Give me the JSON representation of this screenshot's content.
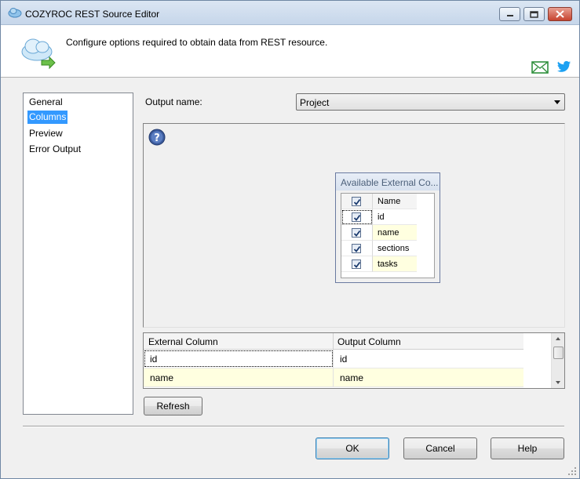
{
  "window": {
    "title": "COZYROC REST Source Editor"
  },
  "header": {
    "description": "Configure options required to obtain data from REST resource.",
    "icons": [
      "cloud-arrow-icon",
      "mail-icon",
      "twitter-icon"
    ]
  },
  "nav": {
    "items": [
      {
        "label": "General",
        "selected": false
      },
      {
        "label": "Columns",
        "selected": true
      },
      {
        "label": "Preview",
        "selected": false
      },
      {
        "label": "Error Output",
        "selected": false
      }
    ]
  },
  "output": {
    "label": "Output name:",
    "value": "Project"
  },
  "external_columns_box": {
    "title": "Available External Co...",
    "header": "Name",
    "header_checked": true,
    "columns": [
      {
        "name": "id",
        "checked": true
      },
      {
        "name": "name",
        "checked": true
      },
      {
        "name": "sections",
        "checked": true
      },
      {
        "name": "tasks",
        "checked": true
      }
    ]
  },
  "mapping": {
    "headers": [
      "External Column",
      "Output Column"
    ],
    "rows": [
      {
        "external": "id",
        "output": "id"
      },
      {
        "external": "name",
        "output": "name"
      }
    ]
  },
  "buttons": {
    "refresh": "Refresh",
    "ok": "OK",
    "cancel": "Cancel",
    "help": "Help"
  },
  "colors": {
    "selection": "#3399ff",
    "alt_row": "#ffffe0"
  }
}
